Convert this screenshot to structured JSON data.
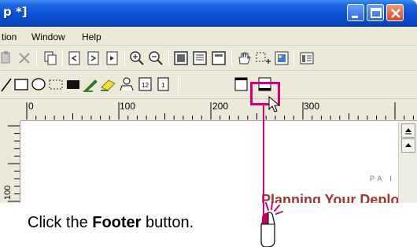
{
  "window": {
    "title": "p *]",
    "controls": [
      "minimize-icon",
      "maximize-icon",
      "close-icon"
    ]
  },
  "menubar": {
    "items": [
      {
        "label": "tion"
      },
      {
        "label": "Window"
      },
      {
        "label": "Help"
      }
    ]
  },
  "toolbar1": {
    "icons": [
      "paste-icon",
      "delete-icon",
      "copy-icon",
      "page-prev-icon",
      "page-next-icon",
      "page-add-icon",
      "zoom-in-icon",
      "zoom-out-icon",
      "view-page-icon",
      "view-two-icon",
      "view-full-icon",
      "hand-tool-icon",
      "select-add-icon",
      "insert-picture-icon",
      "preview-icon"
    ]
  },
  "toolbar2": {
    "icons": [
      "line-tool-icon",
      "rectangle-tool-icon",
      "ellipse-tool-icon",
      "dashed-box-icon",
      "fill-box-icon",
      "pen-tool-icon",
      "eraser-tool-icon",
      "person-tool-icon",
      "page-number-icon",
      "page-number-1-icon",
      "header-icon",
      "footer-icon"
    ]
  },
  "ruler": {
    "labels": [
      "0",
      "100",
      "200",
      "300"
    ],
    "vertical_label": "100"
  },
  "document": {
    "pa_text": "PA I",
    "heading_text": "Planning Your Deploym"
  },
  "caption": {
    "prefix": "Click the ",
    "bold": "Footer",
    "suffix": " button."
  },
  "colors": {
    "callout": "#d1007a",
    "titlebar": "#0a4fd6",
    "heading": "#a5342d"
  }
}
